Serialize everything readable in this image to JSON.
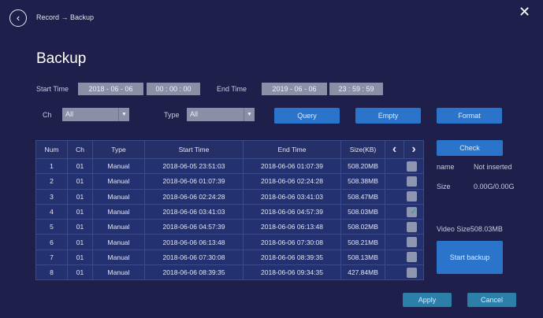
{
  "header": {
    "breadcrumb": "Record → Backup",
    "title": "Backup"
  },
  "filters": {
    "start_label": "Start Time",
    "start_date": "2018 - 06 - 06",
    "start_time": "00 : 00 : 00",
    "end_label": "End Time",
    "end_date": "2019 - 06 - 06",
    "end_time": "23 : 59 : 59",
    "ch_label": "Ch",
    "ch_value": "All",
    "type_label": "Type",
    "type_value": "All"
  },
  "buttons": {
    "query": "Query",
    "empty": "Empty",
    "format": "Format",
    "check": "Check",
    "start_backup": "Start backup",
    "apply": "Apply",
    "cancel": "Cancel"
  },
  "table": {
    "headers": [
      "Num",
      "Ch",
      "Type",
      "Start Time",
      "End Time",
      "Size(KB)"
    ],
    "rows": [
      [
        "1",
        "01",
        "Manual",
        "2018-06-05 23:51:03",
        "2018-06-06 01:07:39",
        "508.20MB",
        false
      ],
      [
        "2",
        "01",
        "Manual",
        "2018-06-06 01:07:39",
        "2018-06-06 02:24:28",
        "508.38MB",
        false
      ],
      [
        "3",
        "01",
        "Manual",
        "2018-06-06 02:24:28",
        "2018-06-06 03:41:03",
        "508.47MB",
        false
      ],
      [
        "4",
        "01",
        "Manual",
        "2018-06-06 03:41:03",
        "2018-06-06 04:57:39",
        "508.03MB",
        true
      ],
      [
        "5",
        "01",
        "Manual",
        "2018-06-06 04:57:39",
        "2018-06-06 06:13:48",
        "508.02MB",
        false
      ],
      [
        "6",
        "01",
        "Manual",
        "2018-06-06 06:13:48",
        "2018-06-06 07:30:08",
        "508.21MB",
        false
      ],
      [
        "7",
        "01",
        "Manual",
        "2018-06-06 07:30:08",
        "2018-06-06 08:39:35",
        "508.13MB",
        false
      ],
      [
        "8",
        "01",
        "Manual",
        "2018-06-06 08:39:35",
        "2018-06-06 09:34:35",
        "427.84MB",
        false
      ]
    ]
  },
  "device": {
    "name_label": "name",
    "name_value": "Not inserted",
    "size_label": "Size",
    "size_value": "0.00G/0.00G",
    "video_size": "Video Size508.03MB"
  }
}
